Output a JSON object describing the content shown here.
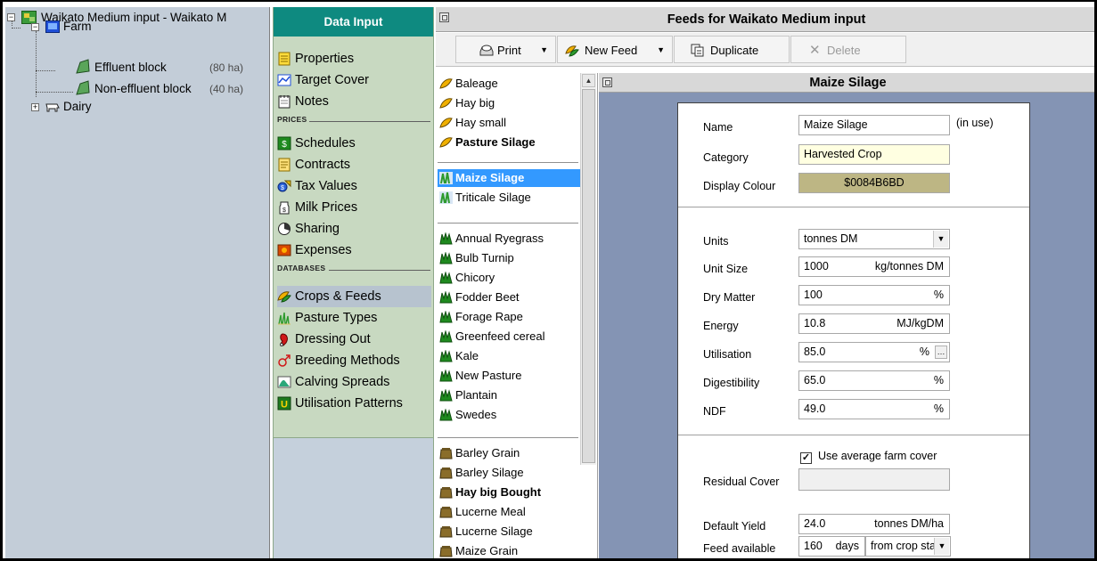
{
  "tree": {
    "root": "Waikato Medium input - Waikato M",
    "farm": "Farm",
    "blocks": [
      {
        "name": "Effluent block",
        "area": "(80 ha)"
      },
      {
        "name": "Non-effluent block",
        "area": "(40 ha)"
      }
    ],
    "dairy": "Dairy"
  },
  "nav": {
    "header": "Data Input",
    "items_top": [
      "Properties",
      "Target Cover",
      "Notes"
    ],
    "prices_label": "PRICES",
    "prices_items": [
      "Schedules",
      "Contracts",
      "Tax Values",
      "Milk Prices",
      "Sharing",
      "Expenses"
    ],
    "databases_label": "DATABASES",
    "databases_items": [
      "Crops & Feeds",
      "Pasture Types",
      "Dressing Out",
      "Breeding Methods",
      "Calving Spreads",
      "Utilisation Patterns"
    ],
    "selected": "Crops & Feeds"
  },
  "feeds": {
    "title": "Feeds for Waikato Medium input",
    "toolbar": {
      "print": "Print",
      "new_feed": "New Feed",
      "duplicate": "Duplicate",
      "delete": "Delete"
    },
    "list": {
      "group1": [
        {
          "name": "Baleage",
          "bold": false
        },
        {
          "name": "Hay big",
          "bold": false
        },
        {
          "name": "Hay small",
          "bold": false
        },
        {
          "name": "Pasture Silage",
          "bold": true
        }
      ],
      "group2": [
        {
          "name": "Maize Silage",
          "bold": true,
          "selected": true
        },
        {
          "name": "Triticale Silage",
          "bold": false
        }
      ],
      "group3": [
        {
          "name": "Annual Ryegrass",
          "bold": false
        },
        {
          "name": "Bulb Turnip",
          "bold": false
        },
        {
          "name": "Chicory",
          "bold": false
        },
        {
          "name": "Fodder Beet",
          "bold": false
        },
        {
          "name": "Forage Rape",
          "bold": false
        },
        {
          "name": "Greenfeed cereal",
          "bold": false
        },
        {
          "name": "Kale",
          "bold": false
        },
        {
          "name": "New Pasture",
          "bold": false
        },
        {
          "name": "Plantain",
          "bold": false
        },
        {
          "name": "Swedes",
          "bold": false
        }
      ],
      "group4": [
        {
          "name": "Barley Grain",
          "bold": false
        },
        {
          "name": "Barley Silage",
          "bold": false
        },
        {
          "name": "Hay big Bought",
          "bold": true
        },
        {
          "name": "Lucerne Meal",
          "bold": false
        },
        {
          "name": "Lucerne Silage",
          "bold": false
        },
        {
          "name": "Maize Grain",
          "bold": false
        }
      ]
    }
  },
  "detail": {
    "title": "Maize Silage",
    "name_label": "Name",
    "name_value": "Maize Silage",
    "in_use": "(in use)",
    "category_label": "Category",
    "category_value": "Harvested Crop",
    "colour_label": "Display Colour",
    "colour_value": "$0084B6BD",
    "colour_hex": "#bdb684",
    "units_label": "Units",
    "units_value": "tonnes DM",
    "unit_size_label": "Unit Size",
    "unit_size_value": "1000",
    "unit_size_unit": "kg/tonnes DM",
    "dry_matter_label": "Dry Matter",
    "dry_matter_value": "100",
    "dry_matter_unit": "%",
    "energy_label": "Energy",
    "energy_value": "10.8",
    "energy_unit": "MJ/kgDM",
    "utilisation_label": "Utilisation",
    "utilisation_value": "85.0",
    "utilisation_unit": "%",
    "digestibility_label": "Digestibility",
    "digestibility_value": "65.0",
    "digestibility_unit": "%",
    "ndf_label": "NDF",
    "ndf_value": "49.0",
    "ndf_unit": "%",
    "residual_label": "Residual Cover",
    "use_avg_label": "Use average farm cover",
    "use_avg_checked": true,
    "default_yield_label": "Default Yield",
    "default_yield_value": "24.0",
    "default_yield_unit": "tonnes DM/ha",
    "feed_avail_label": "Feed available",
    "feed_avail_value": "160",
    "feed_avail_unit": "days",
    "feed_avail_from": "from crop start"
  }
}
